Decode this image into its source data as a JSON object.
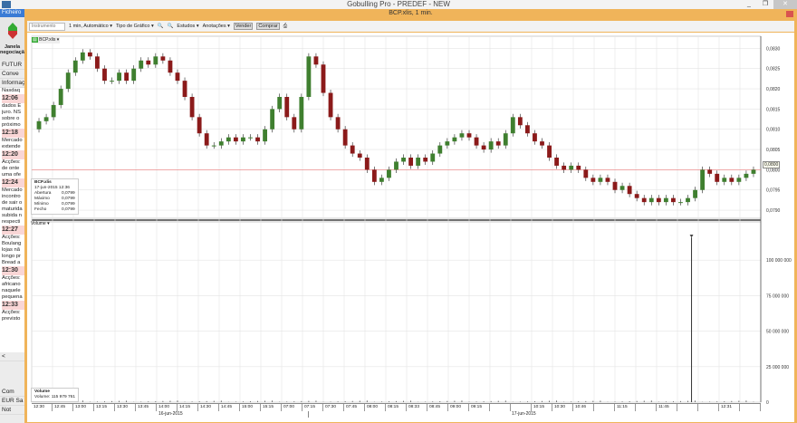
{
  "window": {
    "title": "Gobulling Pro - PREDEF - NEW",
    "min": "_",
    "max": "❐",
    "close": "✕"
  },
  "left": {
    "menu": "Ficheiro ▾",
    "janela": "Janela negociação",
    "futur": "FUTUR",
    "conv": "Conve",
    "info": "Informaçõ",
    "nasdaq": "Nasdaq",
    "news": [
      {
        "time": "12:06",
        "lines": [
          "dados E",
          "juro. NS",
          "sobre o",
          "próximo"
        ]
      },
      {
        "time": "12:18",
        "lines": [
          "Mercado",
          "extende"
        ]
      },
      {
        "time": "12:20",
        "lines": [
          "Acções:",
          "de onte",
          "uma ofe"
        ]
      },
      {
        "time": "12:24",
        "lines": [
          "Mercado",
          "incontro",
          "de sair o",
          "maturida",
          "subida n",
          "respecti"
        ]
      },
      {
        "time": "12:27",
        "lines": [
          "Acções:",
          "Boulang",
          "lojas nã",
          "longo pr",
          "Bread a"
        ]
      },
      {
        "time": "12:30",
        "lines": [
          "Acções:",
          "africano",
          "naquele",
          "pequena"
        ]
      },
      {
        "time": "12:33",
        "lines": [
          "Acções:",
          "previsto"
        ]
      }
    ],
    "scroll_left": "<",
    "com": "Com",
    "eur": "EUR",
    "sa": "Sa",
    "not": "Not"
  },
  "chart_window": {
    "title": "BCP.xlis, 1 min."
  },
  "toolbar": {
    "instrument_placeholder": "Instrumento",
    "interval": "1 min, Automático ▾",
    "chart_type": "Tipo de Gráfico ▾",
    "studies": "Estudos ▾",
    "annotations": "Anotações ▾",
    "sell": "Vender",
    "buy": "Comprar"
  },
  "price_panel": {
    "symbol": "BCP.xlis ▾",
    "current_price": "0,0800",
    "info": {
      "name": "BCP.xlis",
      "datetime": "17-jun-2015 12:36",
      "rows": [
        [
          "Abertura",
          "0,0799"
        ],
        [
          "Máximo",
          "0,0799"
        ],
        [
          "Mínimo",
          "0,0799"
        ],
        [
          "Fecho",
          "0,0799"
        ]
      ]
    }
  },
  "volume_panel": {
    "label": "Volume ▾",
    "info_title": "Volume",
    "info_label": "Volume:",
    "info_value": "115 979 761"
  },
  "dates": [
    "16-jun-2015",
    "17-jun-2015"
  ],
  "chart_data": {
    "type": "candlestick",
    "ylim": [
      0.0788,
      0.0833
    ],
    "yticks": [
      "0,0830",
      "0,0825",
      "0,0820",
      "0,0815",
      "0,0810",
      "0,0805",
      "0,0800",
      "0,0795",
      "0,0790"
    ],
    "ytick_values": [
      0.083,
      0.0825,
      0.082,
      0.0815,
      0.081,
      0.0805,
      0.08,
      0.0795,
      0.079
    ],
    "xticks": [
      "12:30",
      "12:45",
      "13:00",
      "13:15",
      "13:30",
      "13:45",
      "14:00",
      "14:15",
      "14:30",
      "14:45",
      "15:00",
      "15:15",
      "07:00",
      "07:15",
      "07:30",
      "07:45",
      "08:00",
      "08:15",
      "08:33",
      "08:45",
      "09:00",
      "09:15",
      "",
      "",
      "10:15",
      "10:30",
      "10:46",
      "",
      "11:15",
      "",
      "11:45",
      "",
      "",
      "12:31",
      ""
    ],
    "closes": [
      0.0812,
      0.0813,
      0.0816,
      0.082,
      0.0824,
      0.0827,
      0.0829,
      0.0828,
      0.0825,
      0.0822,
      0.0822,
      0.0824,
      0.0822,
      0.0825,
      0.0827,
      0.0826,
      0.0828,
      0.0827,
      0.0824,
      0.0822,
      0.0818,
      0.0813,
      0.0809,
      0.0806,
      0.0806,
      0.0807,
      0.0808,
      0.0807,
      0.0808,
      0.0808,
      0.0807,
      0.081,
      0.0815,
      0.0818,
      0.0813,
      0.081,
      0.0818,
      0.0828,
      0.0826,
      0.0819,
      0.0813,
      0.081,
      0.0806,
      0.0804,
      0.0803,
      0.08,
      0.0797,
      0.0798,
      0.08,
      0.0802,
      0.0803,
      0.0801,
      0.0803,
      0.0802,
      0.0804,
      0.0806,
      0.0807,
      0.0808,
      0.0809,
      0.0808,
      0.0806,
      0.0805,
      0.0807,
      0.0806,
      0.0809,
      0.0813,
      0.0811,
      0.0809,
      0.0807,
      0.0806,
      0.0803,
      0.0801,
      0.08,
      0.0801,
      0.08,
      0.0798,
      0.0797,
      0.0798,
      0.0797,
      0.0795,
      0.0796,
      0.0794,
      0.0793,
      0.0792,
      0.0793,
      0.0792,
      0.0793,
      0.0792,
      0.0792,
      0.0793,
      0.0795,
      0.08,
      0.0799,
      0.0797,
      0.0798,
      0.0797,
      0.0798,
      0.0799,
      0.08
    ],
    "volume": {
      "ylim": [
        0,
        125000000
      ],
      "yticks": [
        "100 000 000",
        "75 000 000",
        "50 000 000",
        "25 000 000",
        "0"
      ],
      "ytick_values": [
        100000000,
        75000000,
        50000000,
        25000000,
        0
      ],
      "spike_value": 115979761
    }
  }
}
